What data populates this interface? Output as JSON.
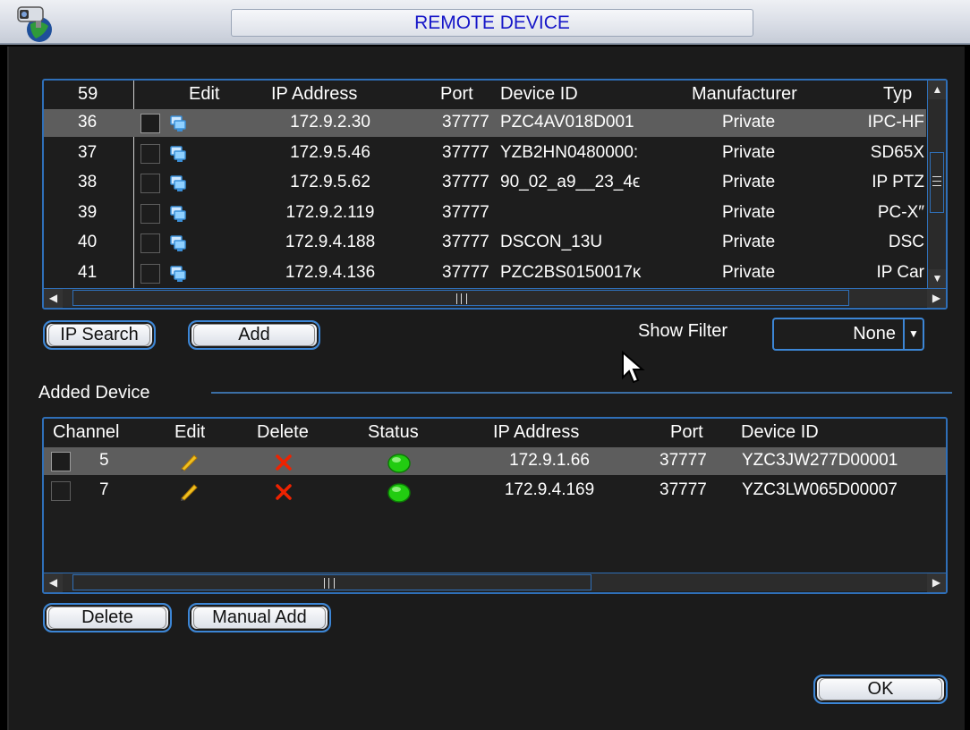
{
  "window": {
    "title": "REMOTE DEVICE"
  },
  "search_table": {
    "columns": [
      "59",
      "Edit",
      "IP Address",
      "Port",
      "Device ID",
      "Manufacturer",
      "Typ"
    ],
    "rows": [
      {
        "num": "36",
        "ip": "172.9.2.30",
        "port": "37777",
        "device_id": "PZC4AV018D001",
        "manufacturer": "Private",
        "type": "IPC-HF",
        "selected": true
      },
      {
        "num": "37",
        "ip": "172.9.5.46",
        "port": "37777",
        "device_id": "YZB2HN0480000:",
        "manufacturer": "Private",
        "type": "SD65X",
        "selected": false
      },
      {
        "num": "38",
        "ip": "172.9.5.62",
        "port": "37777",
        "device_id": "90_02_a9__23_4ϵ",
        "manufacturer": "Private",
        "type": "IP PTZ",
        "selected": false
      },
      {
        "num": "39",
        "ip": "172.9.2.119",
        "port": "37777",
        "device_id": "",
        "manufacturer": "Private",
        "type": "PC-X″",
        "selected": false
      },
      {
        "num": "40",
        "ip": "172.9.4.188",
        "port": "37777",
        "device_id": "DSCON_13U",
        "manufacturer": "Private",
        "type": "DSC",
        "selected": false
      },
      {
        "num": "41",
        "ip": "172.9.4.136",
        "port": "37777",
        "device_id": "PZC2BS0150017ĸ",
        "manufacturer": "Private",
        "type": "IP Car",
        "selected": false
      }
    ]
  },
  "buttons": {
    "ip_search": "IP Search",
    "add": "Add",
    "delete": "Delete",
    "manual_add": "Manual Add",
    "ok": "OK"
  },
  "filter": {
    "label": "Show Filter",
    "value": "None"
  },
  "added_section": {
    "title": "Added Device"
  },
  "added_table": {
    "columns": [
      "Channel",
      "Edit",
      "Delete",
      "Status",
      "IP Address",
      "Port",
      "Device ID"
    ],
    "rows": [
      {
        "channel": "5",
        "ip": "172.9.1.66",
        "port": "37777",
        "device_id": "YZC3JW277D00001",
        "selected": true
      },
      {
        "channel": "7",
        "ip": "172.9.4.169",
        "port": "37777",
        "device_id": "YZC3LW065D00007",
        "selected": false
      }
    ]
  },
  "icons": {
    "app": "camera-globe-icon",
    "edit": "pencil-icon",
    "delete": "red-x-icon",
    "status_ok": "green-dot-icon",
    "network": "network-monitor-icon"
  },
  "colors": {
    "accent": "#2f6fb8",
    "title_text": "#1616c8",
    "selected_row": "#5d5d5d",
    "status_green": "#22cc11",
    "delete_red": "#ee2200"
  }
}
